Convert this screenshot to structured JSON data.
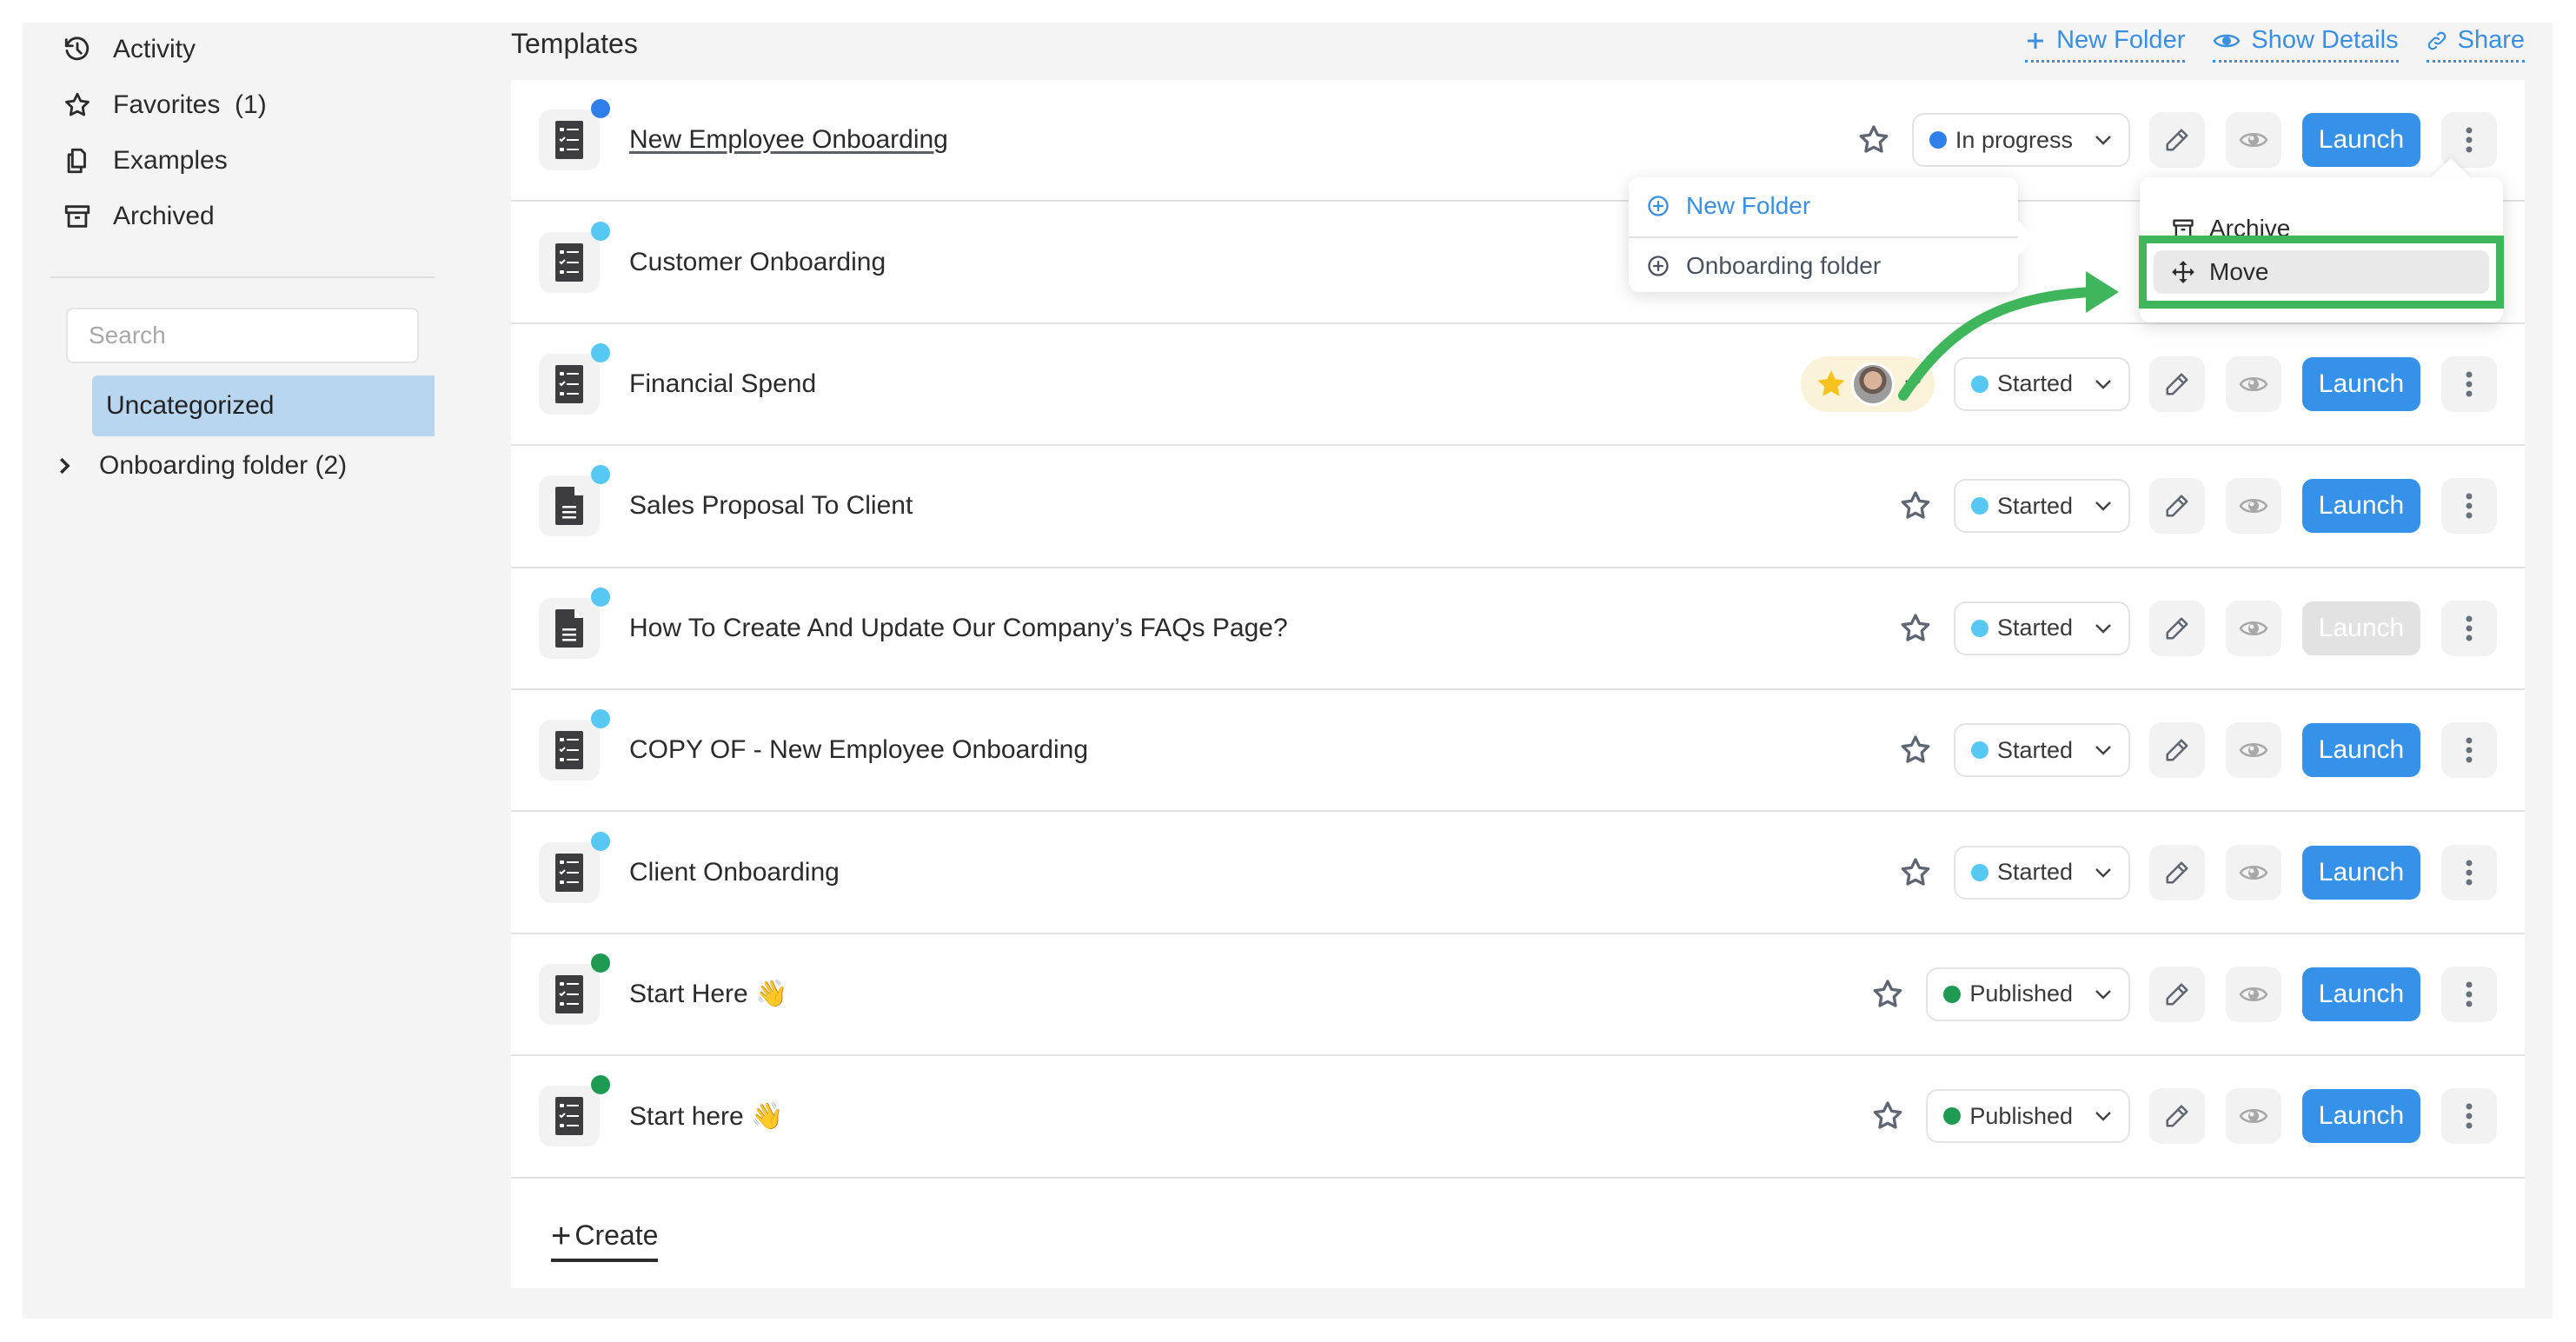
{
  "sidebar": {
    "nav": [
      {
        "label": "Activity",
        "icon": "history-icon"
      },
      {
        "label": "Favorites  (1)",
        "icon": "star-icon"
      },
      {
        "label": "Examples",
        "icon": "copy-icon"
      },
      {
        "label": "Archived",
        "icon": "archive-icon"
      }
    ],
    "search_placeholder": "Search",
    "search_value": "",
    "folders": [
      {
        "label": "Uncategorized",
        "selected": true
      },
      {
        "label": "Onboarding folder (2)",
        "selected": false,
        "expandable": true
      }
    ]
  },
  "header": {
    "title": "Templates",
    "actions": [
      {
        "label": "New Folder",
        "icon": "plus-icon"
      },
      {
        "label": "Show Details",
        "icon": "eye-icon"
      },
      {
        "label": "Share",
        "icon": "link-icon"
      }
    ]
  },
  "templates": [
    {
      "title": "New Employee Onboarding",
      "type": "checklist",
      "dot_color": "#2f7fe8",
      "status": "In progress",
      "status_color": "#2f7fe8",
      "favorite": false,
      "launch": "Launch",
      "launch_enabled": true,
      "underlined": true
    },
    {
      "title": "Customer Onboarding",
      "type": "checklist",
      "dot_color": "#57c7f3",
      "status": "",
      "status_color": "",
      "favorite": false,
      "launch": "",
      "launch_enabled": true,
      "hidden_actions": true
    },
    {
      "title": "Financial Spend",
      "type": "checklist",
      "dot_color": "#57c7f3",
      "status": "Started",
      "status_color": "#57c7f3",
      "favorite": true,
      "launch": "Launch",
      "launch_enabled": true
    },
    {
      "title": "Sales Proposal To Client",
      "type": "document",
      "dot_color": "#57c7f3",
      "status": "Started",
      "status_color": "#57c7f3",
      "favorite": false,
      "launch": "Launch",
      "launch_enabled": true
    },
    {
      "title": "How To Create And Update Our Company’s FAQs Page?",
      "type": "document",
      "dot_color": "#57c7f3",
      "status": "Started",
      "status_color": "#57c7f3",
      "favorite": false,
      "launch": "Launch",
      "launch_enabled": false
    },
    {
      "title": "COPY OF - New Employee Onboarding",
      "type": "checklist",
      "dot_color": "#57c7f3",
      "status": "Started",
      "status_color": "#57c7f3",
      "favorite": false,
      "launch": "Launch",
      "launch_enabled": true
    },
    {
      "title": "Client Onboarding",
      "type": "checklist",
      "dot_color": "#57c7f3",
      "status": "Started",
      "status_color": "#57c7f3",
      "favorite": false,
      "launch": "Launch",
      "launch_enabled": true
    },
    {
      "title": "Start Here 👋",
      "type": "checklist",
      "dot_color": "#1f9a52",
      "status": "Published",
      "status_color": "#1f9a52",
      "favorite": false,
      "launch": "Launch",
      "launch_enabled": true
    },
    {
      "title": "Start here 👋",
      "type": "checklist",
      "dot_color": "#1f9a52",
      "status": "Published",
      "status_color": "#1f9a52",
      "favorite": false,
      "launch": "Launch",
      "launch_enabled": true
    }
  ],
  "create_label": "Create",
  "context_menu": {
    "items": [
      {
        "label": "Archive",
        "icon": "archive-icon"
      },
      {
        "label": "Move",
        "icon": "move-icon",
        "highlighted": true
      }
    ]
  },
  "move_submenu": {
    "items": [
      {
        "label": "New Folder",
        "icon": "plus-circle-icon"
      },
      {
        "label": "Onboarding folder",
        "icon": "plus-circle-icon"
      }
    ]
  },
  "colors": {
    "accent": "#3592e8",
    "annotation_green": "#3fb65c",
    "selected_folder": "#b9d6f0",
    "favorite_star": "#f8c21e"
  }
}
